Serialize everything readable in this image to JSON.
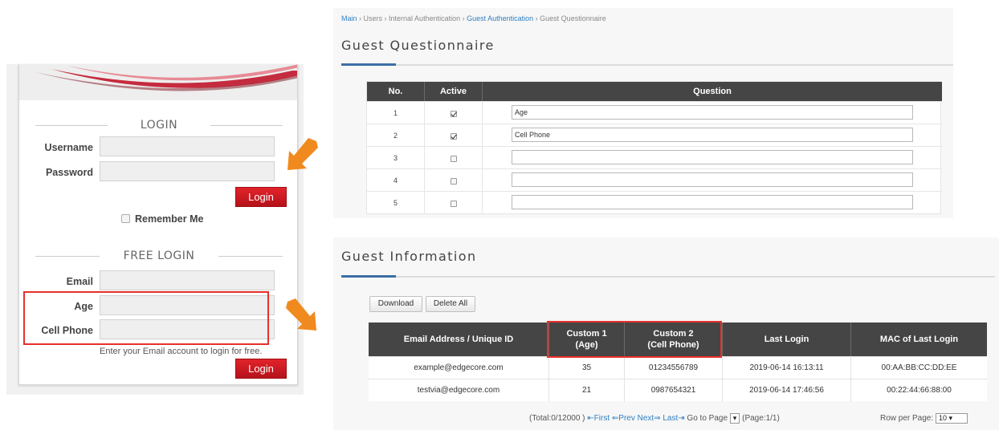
{
  "login": {
    "section_title": "LOGIN",
    "username_label": "Username",
    "password_label": "Password",
    "login_button": "Login",
    "remember_label": "Remember Me",
    "free_title": "FREE LOGIN",
    "email_label": "Email",
    "age_label": "Age",
    "cell_label": "Cell Phone",
    "free_hint": "Enter your Email account to login for free.",
    "free_login_button": "Login"
  },
  "questionnaire": {
    "breadcrumb": [
      {
        "label": "Main",
        "link": true
      },
      {
        "label": "Users",
        "link": false
      },
      {
        "label": "Internal Authentication",
        "link": false
      },
      {
        "label": "Guest Authentication",
        "link": true
      },
      {
        "label": "Guest Questionnaire",
        "link": false
      }
    ],
    "breadcrumb_sep": " › ",
    "title": "Guest Questionnaire",
    "columns": [
      "No.",
      "Active",
      "Question"
    ],
    "rows": [
      {
        "no": "1",
        "active": true,
        "question": "Age"
      },
      {
        "no": "2",
        "active": true,
        "question": "Cell Phone"
      },
      {
        "no": "3",
        "active": false,
        "question": ""
      },
      {
        "no": "4",
        "active": false,
        "question": ""
      },
      {
        "no": "5",
        "active": false,
        "question": ""
      }
    ]
  },
  "guest_info": {
    "title": "Guest Information",
    "download_button": "Download",
    "delete_all_button": "Delete All",
    "columns": [
      "Email Address / Unique ID",
      "Custom 1\n(Age)",
      "Custom 2\n(Cell Phone)",
      "Last Login",
      "MAC of Last Login"
    ],
    "rows": [
      [
        "example@edgecore.com",
        "35",
        "01234556789",
        "2019-06-14 16:13:11",
        "00:AA:BB:CC:DD:EE"
      ],
      [
        "testvia@edgecore.com",
        "21",
        "0987654321",
        "2019-06-14 17:46:56",
        "00:22:44:66:88:00"
      ]
    ],
    "pager": {
      "total": "(Total:0/12000 )",
      "first": "⇤First",
      "prev": "⇐Prev",
      "next": "Next⇒",
      "last": "Last⇥",
      "goto_label": "Go to Page",
      "page_info": "(Page:1/1)",
      "rows_per_page_label": "Row per Page:",
      "rows_per_page_value": "10"
    }
  },
  "colors": {
    "accent_red": "#e8302c",
    "header_dark": "#454545",
    "link_blue": "#2f7fc1",
    "arrow_orange": "#f08a1e"
  }
}
